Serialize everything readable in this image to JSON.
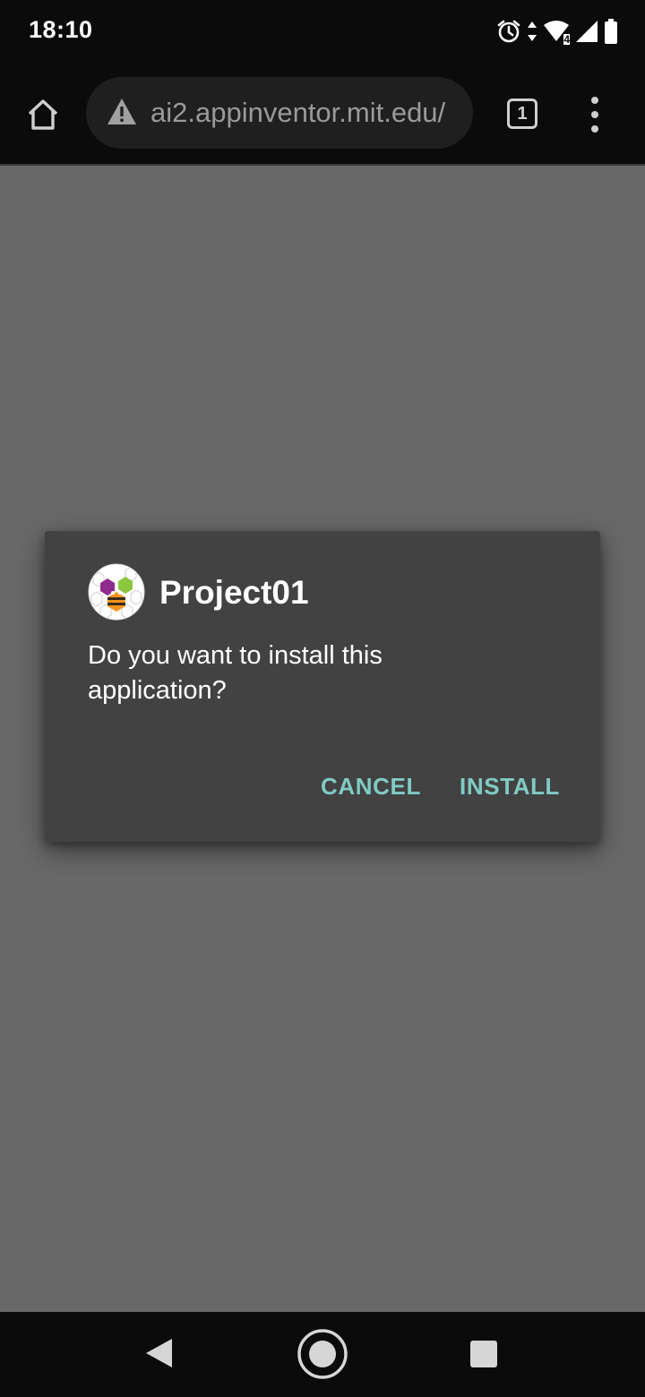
{
  "status_bar": {
    "time": "18:10",
    "network_type": "4",
    "icons": [
      "alarm-icon",
      "data-arrows-icon",
      "wifi-icon",
      "signal-icon",
      "battery-icon"
    ]
  },
  "browser": {
    "url": "ai2.appinventor.mit.edu/",
    "tab_count": "1",
    "icons": [
      "home-icon",
      "warning-icon",
      "tabs-icon",
      "more-vert-icon"
    ]
  },
  "dialog": {
    "app_name": "Project01",
    "message": "Do you want to install this application?",
    "cancel_label": "CANCEL",
    "install_label": "INSTALL",
    "accent_color": "#80cbc4",
    "background_color": "#424242"
  },
  "nav_bar": {
    "icons": [
      "back-icon",
      "home-icon",
      "recents-icon"
    ]
  }
}
